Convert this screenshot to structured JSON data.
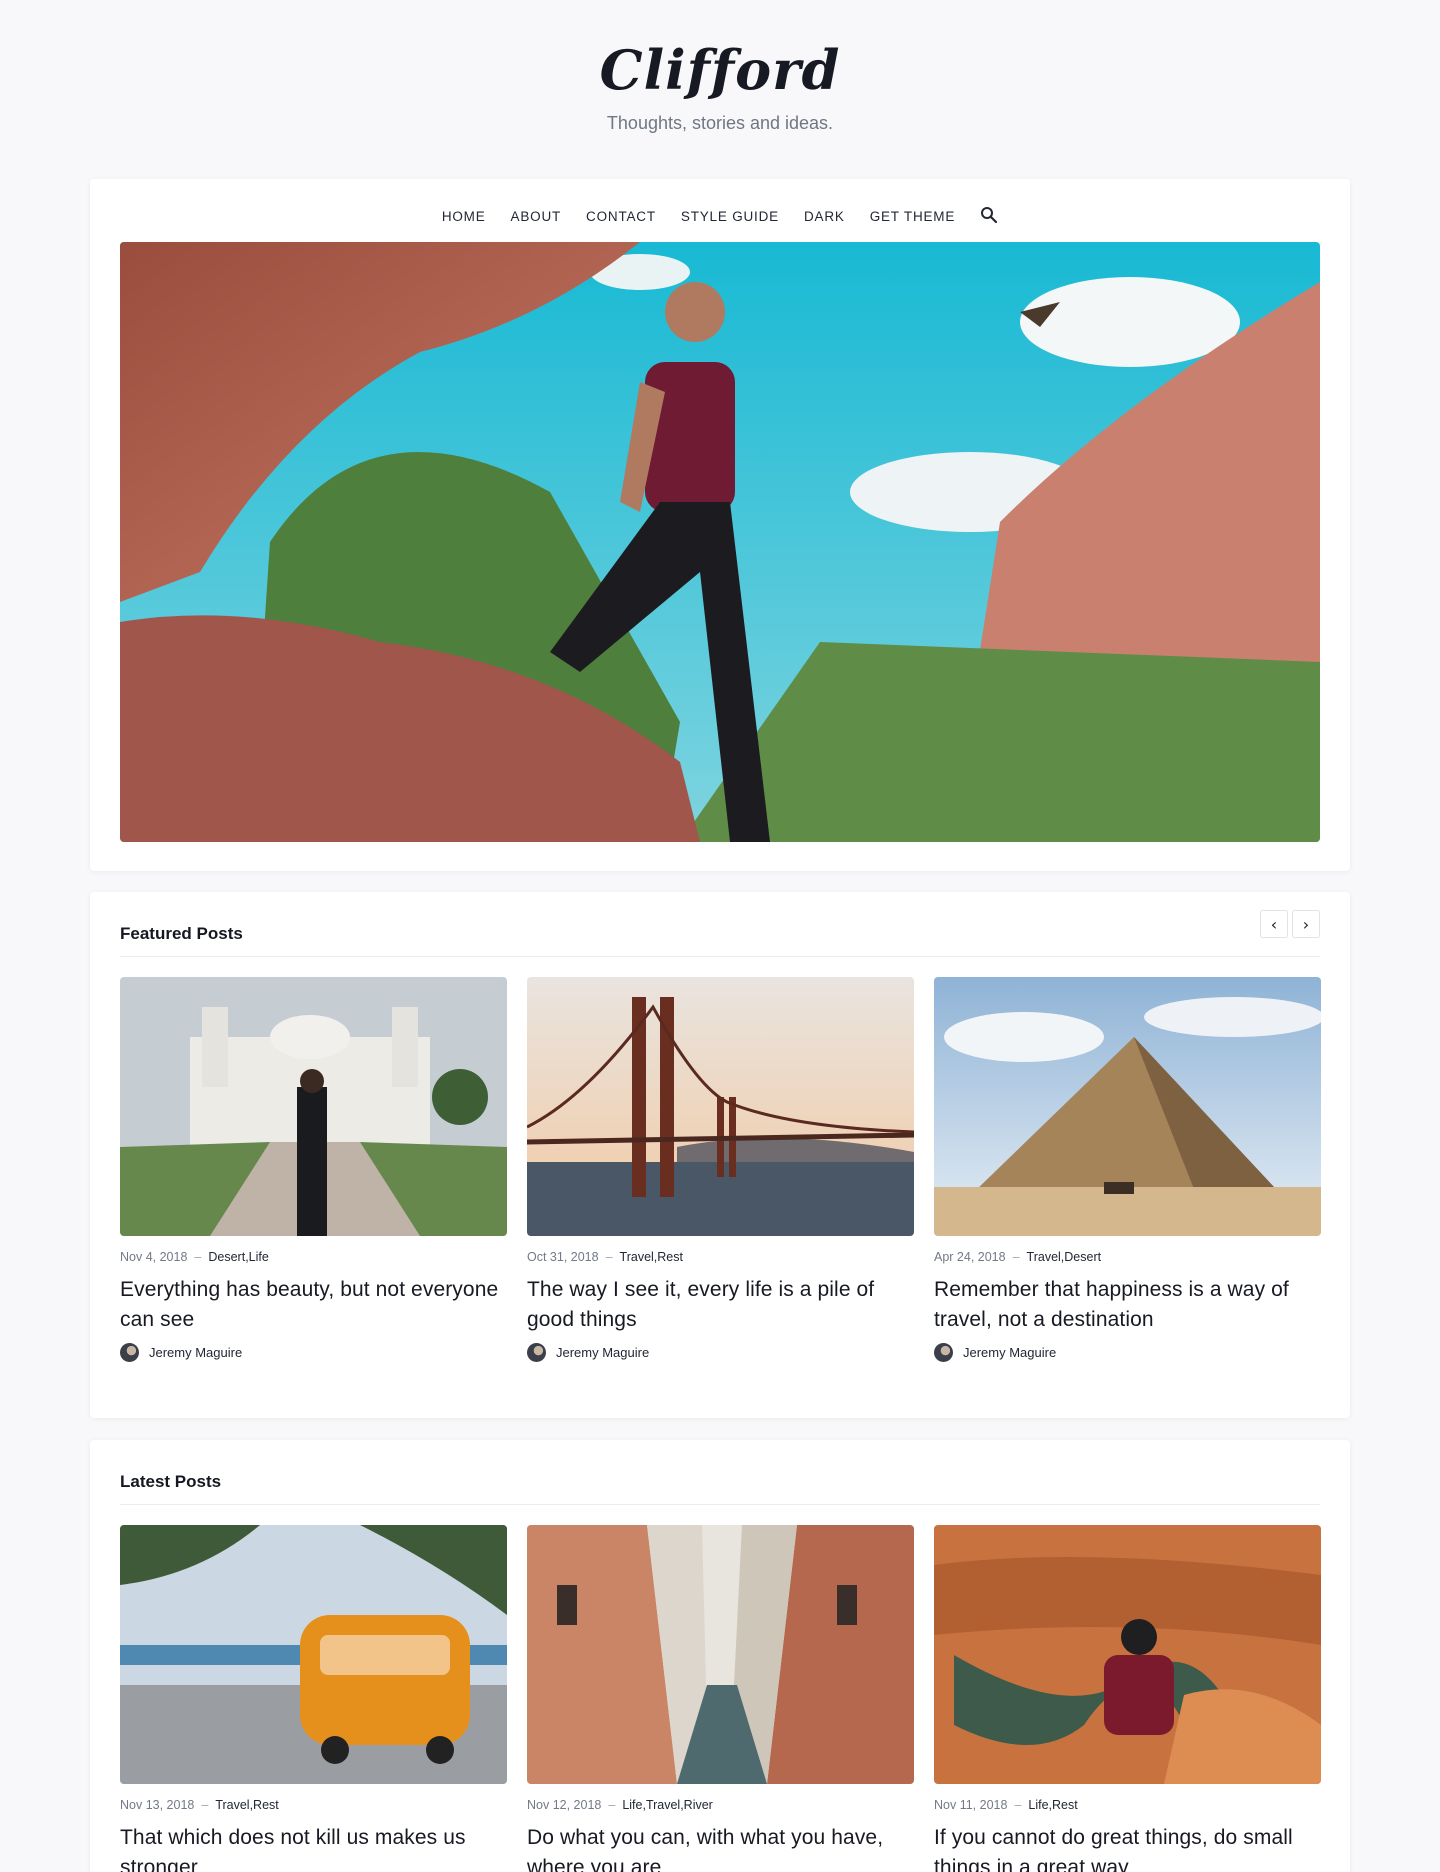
{
  "site": {
    "logo": "Clifford",
    "tagline": "Thoughts, stories and ideas."
  },
  "nav": {
    "items": [
      "HOME",
      "ABOUT",
      "CONTACT",
      "STYLE GUIDE",
      "DARK",
      "GET THEME"
    ],
    "search_icon": "search-icon"
  },
  "featured": {
    "title": "Featured Posts",
    "prev_icon": "‹",
    "next_icon": "›",
    "posts": [
      {
        "date": "Nov 4, 2018",
        "tags": "Desert,Life",
        "title": "Everything has beauty, but not everyone can see",
        "author": "Jeremy Maguire"
      },
      {
        "date": "Oct 31, 2018",
        "tags": "Travel,Rest",
        "title": "The way I see it, every life is a pile of good things",
        "author": "Jeremy Maguire"
      },
      {
        "date": "Apr 24, 2018",
        "tags": "Travel,Desert",
        "title": "Remember that happiness is a way of travel, not a destination",
        "author": "Jeremy Maguire"
      }
    ]
  },
  "latest": {
    "title": "Latest Posts",
    "posts": [
      {
        "date": "Nov 13, 2018",
        "tags": "Travel,Rest",
        "title": "That which does not kill us makes us stronger"
      },
      {
        "date": "Nov 12, 2018",
        "tags": "Life,Travel,River",
        "title": "Do what you can, with what you have, where you are"
      },
      {
        "date": "Nov 11, 2018",
        "tags": "Life,Rest",
        "title": "If you cannot do great things, do small things in a great way"
      }
    ]
  },
  "colors": {
    "background": "#f8f8fa",
    "card": "#ffffff",
    "text": "#171a22",
    "muted": "#737986"
  }
}
